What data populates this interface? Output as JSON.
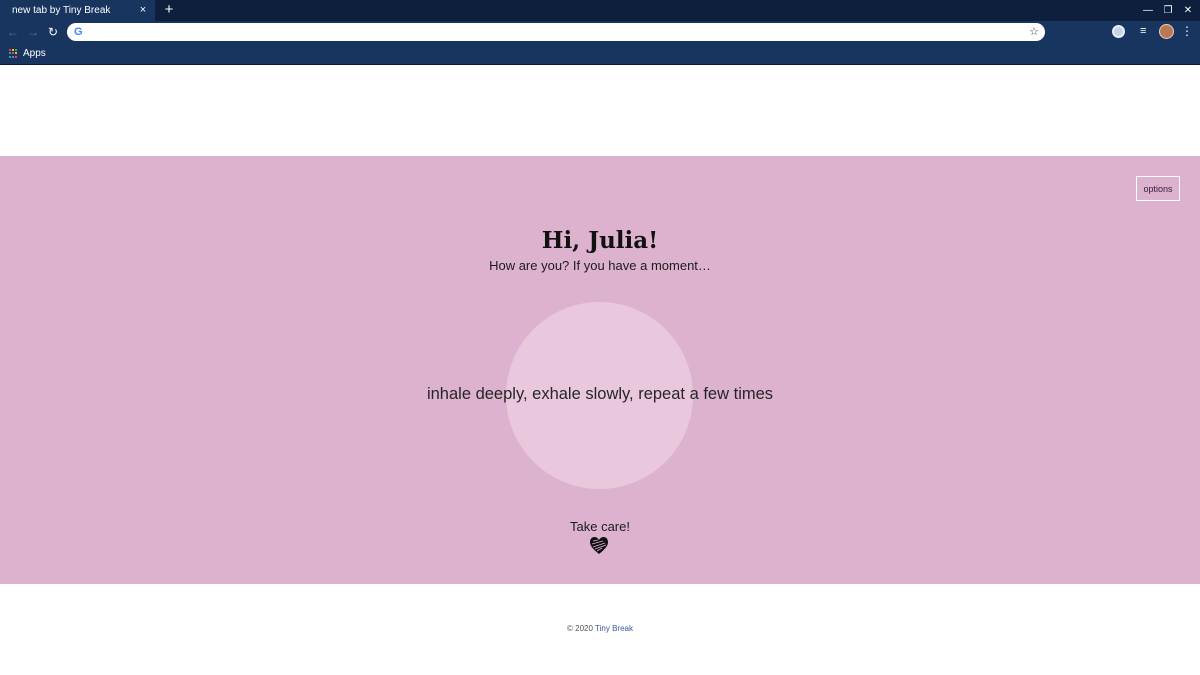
{
  "browser": {
    "tab_title": "new tab by Tiny Break",
    "tab_close": "×",
    "new_tab": "+",
    "omnibox_value": "",
    "bookmarks": [
      {
        "label": "Apps"
      }
    ],
    "colors": {
      "frame": "#17355f",
      "tabstrip": "#0d1f3c"
    }
  },
  "page": {
    "options_label": "options",
    "greeting": "Hi, Julia!",
    "subtitle": "How are you? If you have a moment…",
    "breathing_instruction": "inhale deeply, exhale slowly, repeat a few times",
    "signoff": "Take care!",
    "heart_icon": "heart-icon",
    "colors": {
      "band": "#ddb2cf",
      "circle": "#e9c8de"
    }
  },
  "footer": {
    "copyright": "© 2020",
    "brand_link": "Tiny Break"
  }
}
